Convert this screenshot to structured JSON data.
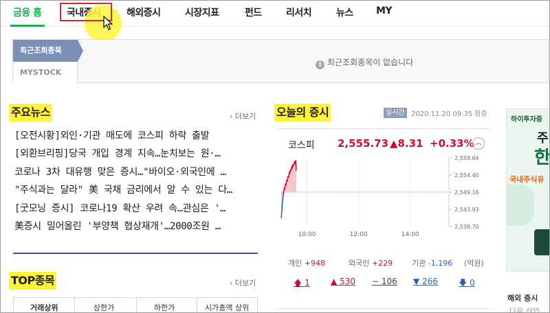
{
  "nav": {
    "items": [
      {
        "label": "금융 홈",
        "active": true
      },
      {
        "label": "국내증시",
        "active": false
      },
      {
        "label": "해외증시",
        "active": false
      },
      {
        "label": "시장지표",
        "active": false
      },
      {
        "label": "펀드",
        "active": false
      },
      {
        "label": "리서치",
        "active": false
      },
      {
        "label": "뉴스",
        "active": false
      },
      {
        "label": "MY",
        "active": false
      }
    ],
    "highlighted": "국내증시"
  },
  "recent": {
    "tab_label": "최근조회종목",
    "mystock_label": "MYSTOCK",
    "empty_message": "최근조회종목이 없습니다",
    "info_icon": "!"
  },
  "news": {
    "heading": "주요뉴스",
    "more": "› 더보기",
    "items": [
      "[오전시황]외인·기관 매도에 코스피 하락 출발",
      "[외환브리핑]당국 개입 경계 지속…눈치보는 원·…",
      "코로나 3차 대유행 맞은 증시…\"바이오·외국인에 …",
      "\"주식과는 달라\" 美 국채 금리에서 알 수 있는 다…",
      "[굿모닝 증시] 코로나19 확산 우려 속…관심은 '…",
      "美증시 밀어올린 '부양책 협상재개'…2000조원 …"
    ]
  },
  "top_stocks": {
    "heading": "TOP종목",
    "more": "› 더보기",
    "tabs": [
      "거래상위",
      "상한가",
      "하한가",
      "시가총액 상위"
    ]
  },
  "market": {
    "heading": "오늘의 증시",
    "live_badge": "실시간",
    "timestamp": "2020.11.20 09:35 장중",
    "index_name": "코스피",
    "index_value": "2,555.73",
    "index_change": "▲8.31",
    "index_pct": "+0.33%",
    "investors": {
      "individual_label": "개인",
      "individual_value": "+948",
      "foreign_label": "외국인",
      "foreign_value": "+229",
      "institution_label": "기관",
      "institution_value": "-1,196",
      "unit": "(억원)"
    },
    "distribution": {
      "upper_limit": "1",
      "up": "530",
      "flat": "106",
      "down": "266",
      "lower_limit": "0"
    },
    "colors": {
      "up": "#c8102e",
      "down": "#1f5fc4"
    }
  },
  "chart_data": {
    "type": "line",
    "title": "",
    "x_ticks": [
      "10:00",
      "12:00",
      "14:00"
    ],
    "y_ticks": [
      "2,559.64",
      "2,554.40",
      "2,549.16",
      "2,543.93",
      "2,538.70"
    ],
    "ylim": [
      2538.7,
      2559.64
    ],
    "baseline": 2549.16,
    "series": [
      {
        "x": [
          "09:00",
          "09:01",
          "09:02",
          "09:03",
          "09:04",
          "09:05",
          "09:06",
          "09:07",
          "09:08",
          "09:09",
          "09:10",
          "09:11",
          "09:12",
          "09:13",
          "09:14",
          "09:15",
          "09:16",
          "09:17",
          "09:18",
          "09:19",
          "09:20",
          "09:21",
          "09:22",
          "09:23",
          "09:24",
          "09:25",
          "09:26",
          "09:27",
          "09:28",
          "09:29",
          "09:30",
          "09:31",
          "09:32",
          "09:33",
          "09:34",
          "09:35"
        ],
        "values": [
          2541.2,
          2542.8,
          2544.5,
          2546.0,
          2547.2,
          2548.5,
          2549.5,
          2550.6,
          2550.0,
          2550.9,
          2551.8,
          2551.2,
          2552.2,
          2553.0,
          2552.4,
          2553.4,
          2554.2,
          2553.6,
          2554.6,
          2555.2,
          2554.8,
          2555.6,
          2556.2,
          2555.7,
          2556.6,
          2557.0,
          2556.4,
          2557.3,
          2557.8,
          2557.2,
          2557.9,
          2558.3,
          2557.8,
          2558.5,
          2558.9,
          2555.73
        ]
      }
    ]
  },
  "ad": {
    "title": "하이투자증",
    "big1": "주",
    "big2": "한",
    "sub": "국내주식유",
    "bottom_title": "해외 증시",
    "bottom_sub": "다우 산업"
  }
}
